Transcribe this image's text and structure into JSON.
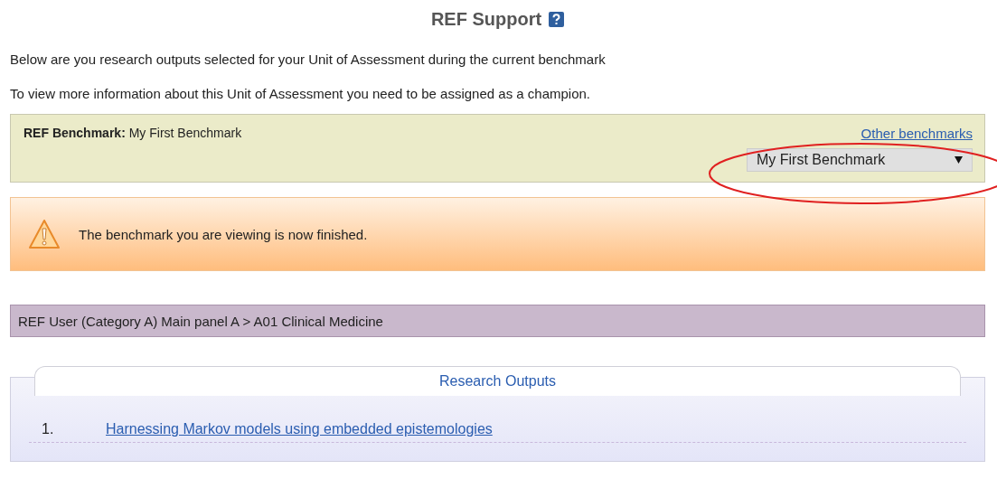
{
  "page_title": "REF Support",
  "intro": [
    "Below are you research outputs selected for your Unit of Assessment during the current benchmark",
    "To view more information about this Unit of Assessment you need to be assigned as a champion."
  ],
  "benchmark": {
    "label": "REF Benchmark:",
    "name": "My First Benchmark",
    "link": "Other benchmarks",
    "select_value": "My First Benchmark"
  },
  "alert": {
    "message": "The benchmark you are viewing is now finished."
  },
  "breadcrumb": "REF User (Category A) Main panel A > A01 Clinical Medicine",
  "outputs": {
    "tab": "Research Outputs",
    "items": [
      {
        "number": "1.",
        "title": "Harnessing Markov models using embedded epistemologies"
      }
    ]
  }
}
